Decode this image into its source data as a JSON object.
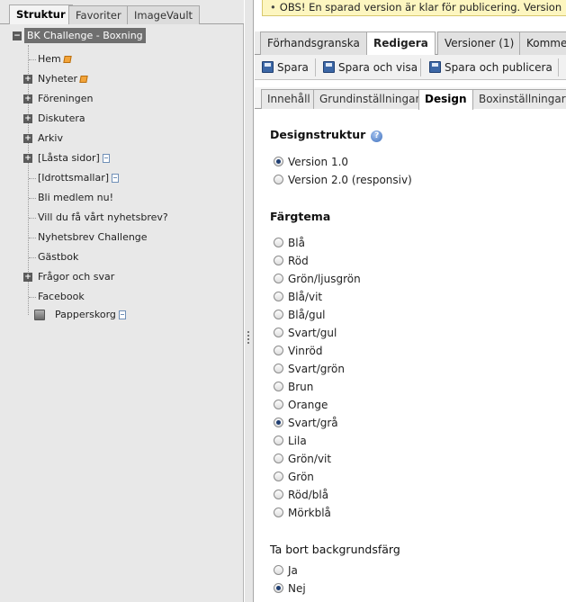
{
  "left_tabs": [
    "Struktur",
    "Favoriter",
    "ImageVault"
  ],
  "tree": {
    "root": "BK Challenge - Boxning",
    "items": [
      {
        "label": "Hem",
        "expandable": false,
        "icon": "flag-icon"
      },
      {
        "label": "Nyheter",
        "expandable": true,
        "icon": "flag-icon"
      },
      {
        "label": "Föreningen",
        "expandable": true,
        "icon": ""
      },
      {
        "label": "Diskutera",
        "expandable": true,
        "icon": ""
      },
      {
        "label": "Arkiv",
        "expandable": true,
        "icon": ""
      },
      {
        "label": "[Låsta sidor]",
        "expandable": true,
        "icon": "page-icon"
      },
      {
        "label": "[Idrottsmallar]",
        "expandable": false,
        "icon": "page-icon"
      },
      {
        "label": "Bli medlem nu!",
        "expandable": false,
        "icon": ""
      },
      {
        "label": "Vill du få vårt nyhetsbrev?",
        "expandable": false,
        "icon": ""
      },
      {
        "label": "Nyhetsbrev Challenge",
        "expandable": false,
        "icon": ""
      },
      {
        "label": "Gästbok",
        "expandable": false,
        "icon": ""
      },
      {
        "label": "Frågor och svar",
        "expandable": true,
        "icon": ""
      },
      {
        "label": "Facebook",
        "expandable": false,
        "icon": ""
      }
    ],
    "trash": "Papperskorg"
  },
  "notice": "OBS! En sparad version är klar för publicering. Version",
  "top_tabs": [
    "Förhandsgranska",
    "Redigera",
    "Versioner (1)",
    "Kommentarer"
  ],
  "toolbar": {
    "save": "Spara",
    "save_view": "Spara och visa",
    "save_publish": "Spara och publicera"
  },
  "sub_tabs": [
    "Innehåll",
    "Grundinställningar",
    "Design",
    "Boxinställningar"
  ],
  "design": {
    "structure_title": "Designstruktur",
    "structure_options": [
      "Version 1.0",
      "Version 2.0 (responsiv)"
    ],
    "structure_selected": 0,
    "theme_title": "Färgtema",
    "theme_options": [
      "Blå",
      "Röd",
      "Grön/ljusgrön",
      "Blå/vit",
      "Blå/gul",
      "Svart/gul",
      "Vinröd",
      "Svart/grön",
      "Brun",
      "Orange",
      "Svart/grå",
      "Lila",
      "Grön/vit",
      "Grön",
      "Röd/blå",
      "Mörkblå"
    ],
    "theme_selected": 10,
    "bg_title": "Ta bort backgrundsfärg",
    "bg_options": [
      "Ja",
      "Nej"
    ],
    "bg_selected": 1
  }
}
